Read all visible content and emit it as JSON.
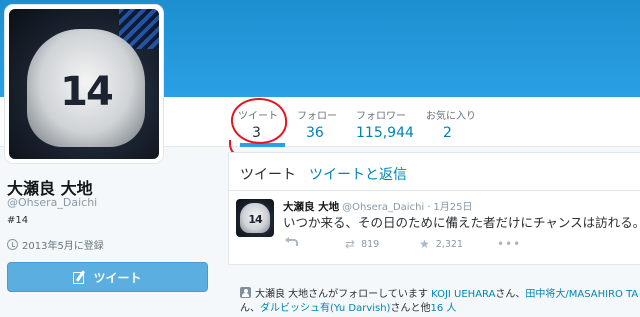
{
  "profile": {
    "avatar_number": "14",
    "name": "大瀬良 大地",
    "handle": "@Ohsera_Daichi",
    "bio": "#14",
    "joined": "2013年5月に登録",
    "tweet_button_label": "ツイート"
  },
  "stats": [
    {
      "label": "ツイート",
      "value": "3",
      "active": true
    },
    {
      "label": "フォロー",
      "value": "36",
      "active": false
    },
    {
      "label": "フォロワー",
      "value": "115,944",
      "active": false
    },
    {
      "label": "お気に入り",
      "value": "2",
      "active": false
    }
  ],
  "timeline": {
    "tabs": [
      "ツイート",
      "ツイートと返信"
    ],
    "tweet": {
      "avatar_number": "14",
      "author": "大瀬良 大地",
      "handle": "@Ohsera_Daichi",
      "separator": "·",
      "date": "1月25日",
      "text": "いつか来る、その日のために備えた者だけにチャンスは訪れる。",
      "retweets": "819",
      "favorites": "2,321",
      "more": "•••"
    }
  },
  "follow_notice": {
    "prefix": "大瀬良 大地さんがフォローしています",
    "user1": "KOJI UEHARA",
    "sep1": "さん、",
    "user2": "田中将大/MASAHIRO TA",
    "line2_start": "ん、",
    "user3": "ダルビッシュ有(Yu Darvish)",
    "sep2": "さんと他",
    "others": "16 人"
  },
  "colors": {
    "banner": "#2aa0e4",
    "link": "#0084b4",
    "tweet_button": "#5aaee0",
    "annotation": "#e8141e"
  }
}
